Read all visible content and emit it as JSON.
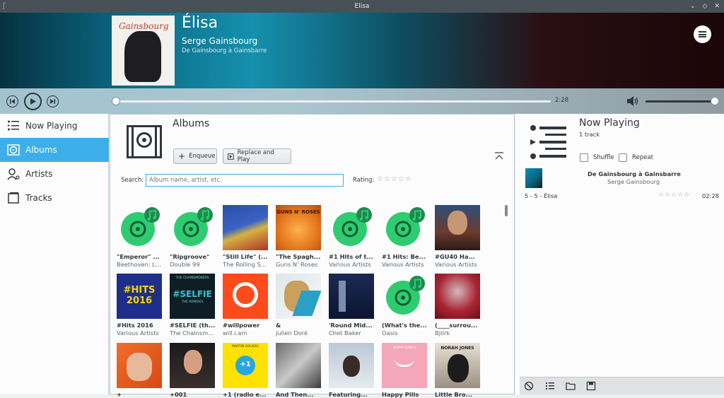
{
  "window": {
    "title": "Elisa"
  },
  "header": {
    "track_title": "Élisa",
    "artist": "Serge Gainsbourg",
    "album": "De Gainsbourg à Gainsbarre",
    "cover_text": "Gainsbourg"
  },
  "transport": {
    "duration": "2:28",
    "position_fraction": 0.0,
    "volume_fraction": 1.0
  },
  "sidebar": {
    "items": [
      {
        "label": "Now Playing",
        "icon": "playlist-icon",
        "active": false
      },
      {
        "label": "Albums",
        "icon": "album-icon",
        "active": true
      },
      {
        "label": "Artists",
        "icon": "artist-icon",
        "active": false
      },
      {
        "label": "Tracks",
        "icon": "tracks-icon",
        "active": false
      }
    ]
  },
  "albums_view": {
    "title": "Albums",
    "enqueue_label": "Enqueue",
    "replace_play_label": "Replace and Play",
    "search_label": "Search:",
    "search_placeholder": "Album name, artist, etc.",
    "rating_label": "Rating:",
    "rows": [
      [
        {
          "title": "\"Emperor\" ...",
          "artist": "Beethoven; L...",
          "cover": "placeholder"
        },
        {
          "title": "\"Ripgroove\"",
          "artist": "Double 99",
          "cover": "placeholder"
        },
        {
          "title": "\"Still Life\" (...",
          "artist": "The Rolling S...",
          "cover": "art-blue-red"
        },
        {
          "title": "\"The Spagh...",
          "artist": "Guns N' Roses",
          "cover": "art-orange"
        },
        {
          "title": "#1 Hits of t...",
          "artist": "Various Artists",
          "cover": "placeholder"
        },
        {
          "title": "#1 Hits: Be...",
          "artist": "Various Artists",
          "cover": "placeholder"
        },
        {
          "title": "#GU40 Ha...",
          "artist": "Various Artists",
          "cover": "art-portrait"
        }
      ],
      [
        {
          "title": "#Hits 2016",
          "artist": "Various Artists",
          "cover": "art-hits"
        },
        {
          "title": "#SELFIE (th...",
          "artist": "The Chainsm...",
          "cover": "art-selfie"
        },
        {
          "title": "#willpower",
          "artist": "will.i.am",
          "cover": "art-willpower"
        },
        {
          "title": "&",
          "artist": "Julien Doré",
          "cover": "art-amp"
        },
        {
          "title": "'Round Mid...",
          "artist": "Chet Baker",
          "cover": "art-navy"
        },
        {
          "title": "(What's the...",
          "artist": "Oasis",
          "cover": "placeholder"
        },
        {
          "title": "(____surrou...",
          "artist": "Björk",
          "cover": "art-red"
        }
      ],
      [
        {
          "title": "+",
          "artist": "",
          "cover": "art-plus"
        },
        {
          "title": "+001",
          "artist": "",
          "cover": "art-dark"
        },
        {
          "title": "+1 (radio e...",
          "artist": "",
          "cover": "art-yellow"
        },
        {
          "title": "And Then...",
          "artist": "",
          "cover": "art-gray"
        },
        {
          "title": "Featuring...",
          "artist": "",
          "cover": "art-light"
        },
        {
          "title": "Happy Pills",
          "artist": "",
          "cover": "art-pink"
        },
        {
          "title": "Little Bro...",
          "artist": "",
          "cover": "art-norah"
        }
      ]
    ],
    "cover_texts": {
      "hits": "#HITS 2016",
      "selfie": "#SELFIE",
      "chainsmokers": "THE CHAINSMOKERS",
      "remixes": "THE REMIXES",
      "plus": "+",
      "yellow": "+1",
      "guns": "GUNS N' ROSES",
      "norah": "NORAH JONES",
      "pink_top": "NORAH JONES",
      "yellow_top": "MARTIN SOLVEIG"
    }
  },
  "now_playing": {
    "title": "Now Playing",
    "count": "1 track",
    "shuffle_label": "Shuffle",
    "repeat_label": "Repeat",
    "track": {
      "album": "De Gainsbourg à Gainsbarre",
      "artist": "Serge Gainsbourg",
      "line": "5 - 5 - Élisa",
      "duration": "02:28",
      "rating": 0
    }
  },
  "colors": {
    "accent": "#3daee9",
    "placeholder_green": "#2ecc71"
  }
}
